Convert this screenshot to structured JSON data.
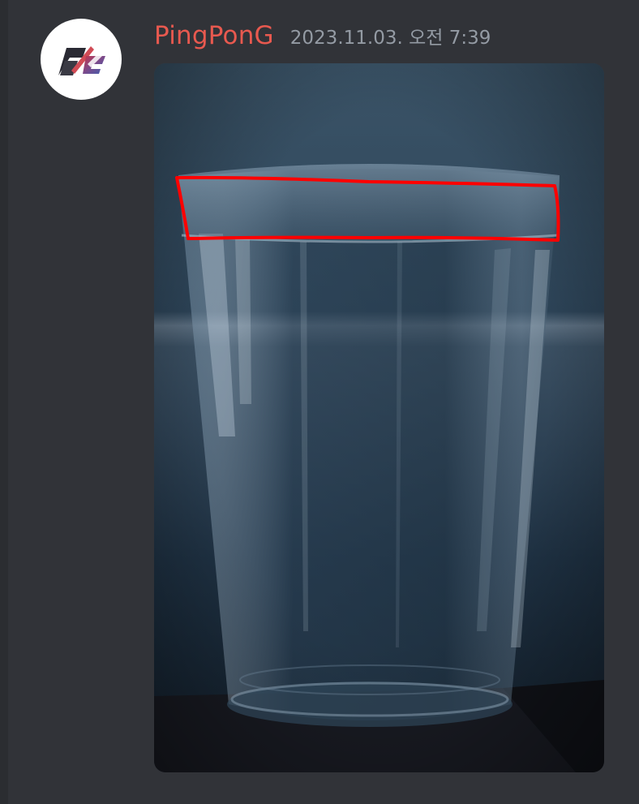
{
  "message": {
    "author": {
      "username": "PingPonG",
      "name_color": "#e8594f",
      "avatar_icon": "pg-logo-icon"
    },
    "timestamp": "2023.11.03. 오전 7:39",
    "attachment": {
      "type": "image",
      "depicts": "glass-with-red-rim-outline",
      "highlight_color": "#ff0000"
    }
  },
  "colors": {
    "background": "#313338",
    "timestamp": "#949ba4"
  }
}
